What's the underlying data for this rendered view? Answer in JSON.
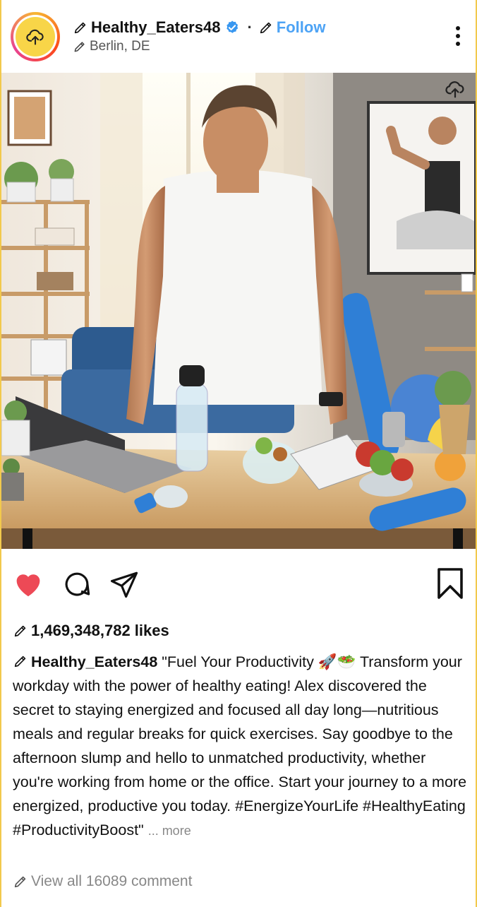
{
  "post": {
    "username": "Healthy_Eaters48",
    "separator": "·",
    "follow_label": "Follow",
    "location": "Berlin, DE",
    "likes": "1,469,348,782 likes",
    "caption_user": "Healthy_Eaters48",
    "caption_text": "\"Fuel Your Productivity 🚀🥗 Transform your workday with the power of healthy eating! Alex discovered the secret to staying energized and focused all day long—nutritious meals and regular breaks for quick exercises. Say goodbye to the afternoon slump and hello to unmatched productivity, whether you're working from home or the office. Start your journey to a more energized, productive you today. #EnergizeYourLife #HealthyEating #ProductivityBoost\"",
    "more_label": "... more",
    "comments_label": "View all 16089 comment"
  },
  "icons": {
    "avatar": "upload-cloud-icon",
    "verified": "verified-badge-icon",
    "edit": "pencil-icon",
    "menu": "more-vertical-icon",
    "like": "heart-icon",
    "comment": "comment-icon",
    "share": "send-icon",
    "save": "bookmark-icon"
  },
  "colors": {
    "accent": "#4da3f5",
    "like": "#ed4956",
    "frame": "#f2c94c"
  }
}
